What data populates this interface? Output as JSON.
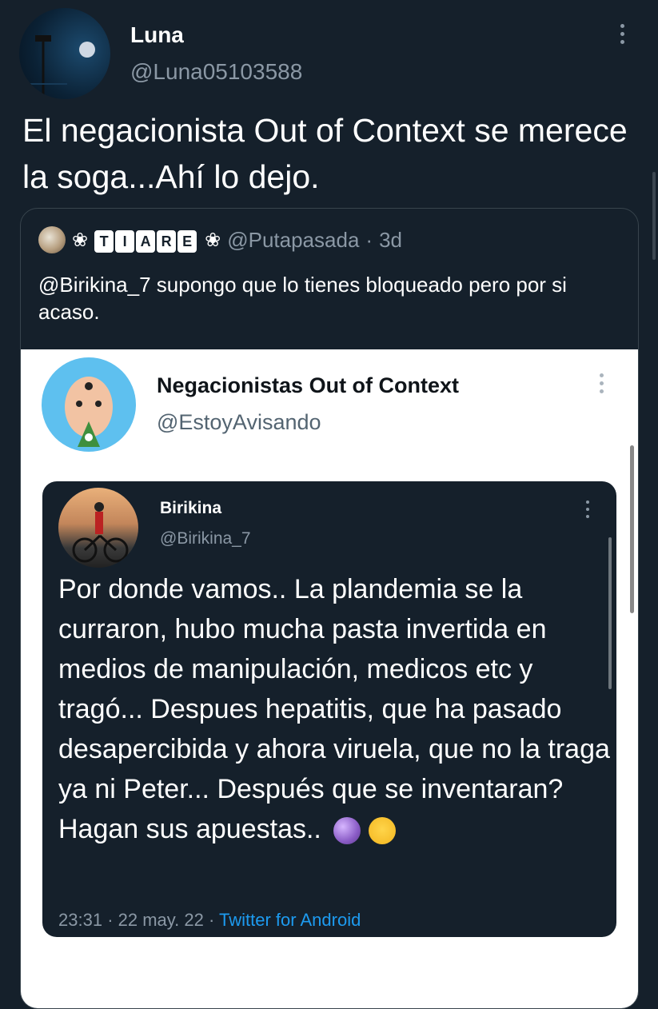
{
  "tweet": {
    "author_name": "Luna",
    "author_handle": "@Luna05103588",
    "text": "El negacionista Out of Context se merece la soga...Ahí lo dejo."
  },
  "quote": {
    "name_letters": [
      "T",
      "I",
      "A",
      "R",
      "E"
    ],
    "handle": "@Putapasada",
    "separator": "·",
    "age": "3d",
    "text": "@Birikina_7 supongo que lo tienes bloqueado pero por si acaso."
  },
  "screenshot": {
    "name": "Negacionistas Out of Context",
    "handle": "@EstoyAvisando"
  },
  "nested": {
    "name": "Birikina",
    "handle": "@Birikina_7",
    "text": "Por donde vamos.. La plandemia se la curraron, hubo mucha pasta invertida en medios de manipulación, medicos etc y tragó... Despues hepatitis, que ha pasado desapercibida y ahora viruela, que no la traga ya ni Peter... Después que se inventaran? Hagan sus apuestas..",
    "time": "23:31",
    "date": "22 may. 22",
    "separator": "·",
    "source": "Twitter for Android"
  },
  "colors": {
    "background": "#15202b",
    "secondary_text": "#8b98a5",
    "link": "#1d9bf0",
    "screenshot_bg": "#ffffff"
  }
}
